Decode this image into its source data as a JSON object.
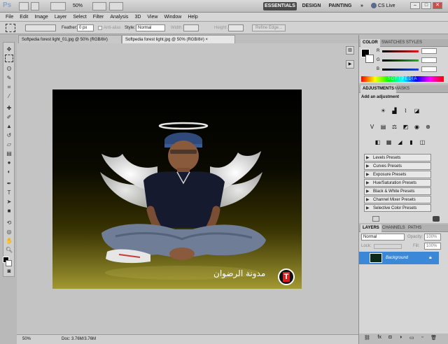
{
  "app": {
    "logo": "Ps",
    "zoom": "50%",
    "workspaces": [
      "ESSENTIALS",
      "DESIGN",
      "PAINTING"
    ],
    "more_workspaces": "»",
    "cs_live": "CS Live"
  },
  "window_controls": [
    "–",
    "□",
    "✕"
  ],
  "menu": [
    "File",
    "Edit",
    "Image",
    "Layer",
    "Select",
    "Filter",
    "Analysis",
    "3D",
    "View",
    "Window",
    "Help"
  ],
  "options": {
    "feather_label": "Feather:",
    "feather_value": "0 px",
    "antialias_label": "Anti-alias",
    "style_label": "Style:",
    "style_value": "Normal",
    "width_label": "Width:",
    "height_label": "Height:",
    "refine_label": "Refine Edge..."
  },
  "tabs": [
    "Softpedia forest light_01.jpg @ 50% (RGB/8#)",
    "Softpedia forest light.jpg @ 50% (RGB/8#) ×"
  ],
  "image": {
    "watermark": "مدونة الرضوان",
    "logo_letter": "T"
  },
  "status": {
    "zoom": "50%",
    "doc": "Doc: 3.76M/3.76M"
  },
  "color_panel": {
    "tabs": [
      "COLOR",
      "SWATCHES",
      "STYLES"
    ],
    "channels": [
      {
        "label": "R",
        "color": "#e01919"
      },
      {
        "label": "G",
        "color": "#19b919"
      },
      {
        "label": "B",
        "color": "#1947e0"
      }
    ],
    "spectrum_text": "SOFTPEDIA"
  },
  "adjust_panel": {
    "tabs": [
      "ADJUSTMENTS",
      "MASKS"
    ],
    "heading": "Add an adjustment",
    "presets": [
      "Levels Presets",
      "Curves Presets",
      "Exposure Presets",
      "Hue/Saturation Presets",
      "Black & White Presets",
      "Channel Mixer Presets",
      "Selective Color Presets"
    ]
  },
  "layers_panel": {
    "tabs": [
      "LAYERS",
      "CHANNELS",
      "PATHS"
    ],
    "blend_mode": "Normal",
    "opacity_label": "Opacity:",
    "opacity_value": "100%",
    "lock_label": "Lock:",
    "fill_label": "Fill:",
    "fill_value": "100%",
    "layer_name": "Background"
  },
  "colors": {
    "accent": "#3b88d8",
    "active_workspace": "#4a4a4a"
  }
}
